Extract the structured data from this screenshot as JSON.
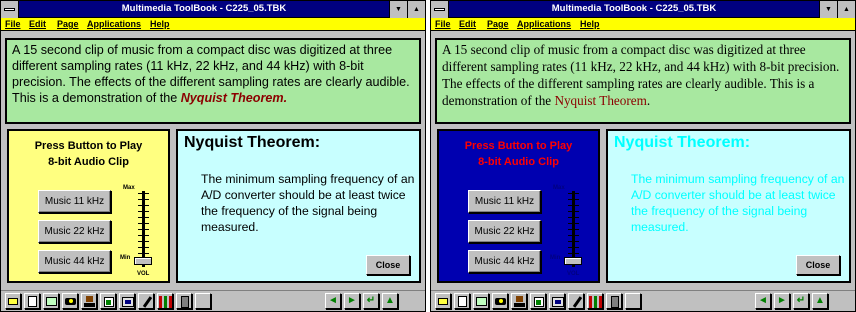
{
  "window_title": "Multimedia ToolBook - C225_05.TBK",
  "title_buttons": {
    "minimize": "▼",
    "maximize": "▲"
  },
  "menu": [
    "File",
    "Edit",
    "Page",
    "Applications",
    "Help"
  ],
  "text_panel": {
    "body": "A 15 second clip of music from a compact disc was digitized at three different sampling rates (11 kHz, 22 kHz, and 44 kHz) with 8-bit precision.  The effects of the different sampling rates are clearly audible.  This is a demonstration of the ",
    "link_text": "Nyquist Theorem",
    "period": "."
  },
  "left_panel": {
    "title_line1": "Press Button to Play",
    "title_line2": "8-bit Audio Clip",
    "buttons": [
      "Music 11 kHz",
      "Music 22 kHz",
      "Music 44 kHz"
    ],
    "slider_max": "Max",
    "slider_min": "Min",
    "slider_label": "VOL"
  },
  "right_panel": {
    "title": "Nyquist Theorem:",
    "body": "The minimum sampling frequency of an A/D converter should be at least twice the frequency of the signal being measured.",
    "close": "Close"
  },
  "toolbar": {
    "tools": [
      "folder-icon",
      "page-icon",
      "card-icon",
      "camera-icon",
      "stamp-icon",
      "bag-icon",
      "tape-icon",
      "pen-icon",
      "color-bars-icon",
      "calculator-icon",
      "blank-button"
    ],
    "nav": [
      "arrow-left-icon",
      "arrow-right-icon",
      "arrow-return-icon",
      "arrow-up-icon"
    ]
  },
  "colors": {
    "title_bar": "#000080",
    "menu_bar": "#ffff00",
    "text_panel": "#a8e8a0",
    "left_panel_a": "#ffff80",
    "left_panel_b": "#0000b0",
    "right_panel": "#c8ffff",
    "heading_b": "#00ffff",
    "press_label_b": "#ff0000",
    "link": "#8b0000"
  }
}
